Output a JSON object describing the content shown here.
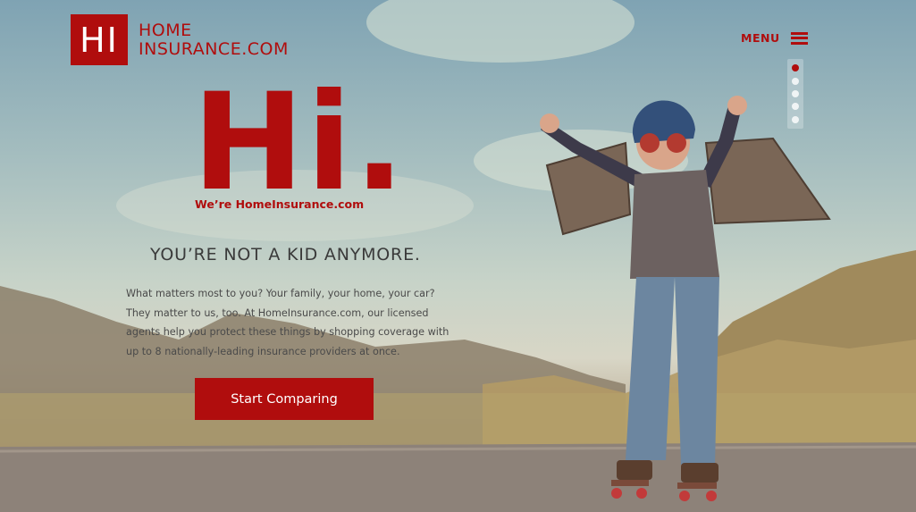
{
  "logo": {
    "mark": "HI",
    "line1": "HOME",
    "line2": "INSURANCE.COM"
  },
  "menu": {
    "label": "MENU",
    "icon": "hamburger-icon"
  },
  "slider": {
    "count": 5,
    "active_index": 0
  },
  "hero": {
    "big_text": "Hi.",
    "tagline": "We’re HomeInsurance.com",
    "headline": "YOU’RE NOT A KID ANYMORE.",
    "body": "What matters most to you? Your family, your home, your car? They matter to us, too. At HomeInsurance.com, our licensed agents help you protect these things by shopping coverage with up to 8 nationally-leading insurance providers at once.",
    "cta_label": "Start Comparing"
  },
  "colors": {
    "brand_red": "#b00d0d"
  }
}
